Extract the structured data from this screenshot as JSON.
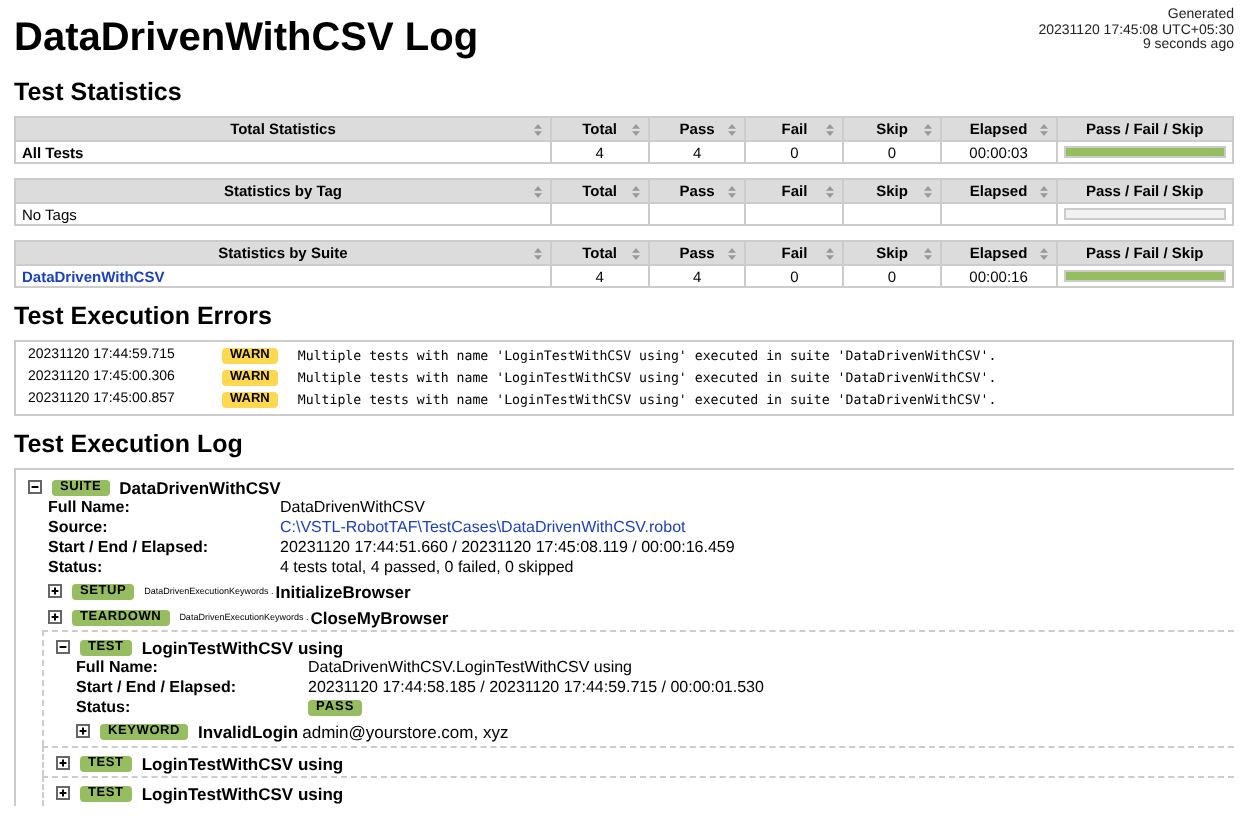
{
  "title": "DataDrivenWithCSV Log",
  "generated": {
    "label": "Generated",
    "timestamp": "20231120 17:45:08 UTC+05:30",
    "ago": "9 seconds ago"
  },
  "statistics": {
    "heading": "Test Statistics",
    "tables": [
      {
        "columns": [
          {
            "label": "Total Statistics",
            "sortable": true
          },
          {
            "label": "Total",
            "sortable": true
          },
          {
            "label": "Pass",
            "sortable": true
          },
          {
            "label": "Fail",
            "sortable": true
          },
          {
            "label": "Skip",
            "sortable": true
          },
          {
            "label": "Elapsed",
            "sortable": true
          },
          {
            "label": "Pass / Fail / Skip",
            "sortable": false
          }
        ],
        "rows": [
          {
            "label": "All Tests",
            "link": false,
            "bold": true,
            "total": "4",
            "pass": "4",
            "fail": "0",
            "skip": "0",
            "elapsed": "00:00:03",
            "level": 1
          }
        ]
      },
      {
        "columns": [
          {
            "label": "Statistics by Tag",
            "sortable": true
          },
          {
            "label": "Total",
            "sortable": true
          },
          {
            "label": "Pass",
            "sortable": true
          },
          {
            "label": "Fail",
            "sortable": true
          },
          {
            "label": "Skip",
            "sortable": true
          },
          {
            "label": "Elapsed",
            "sortable": true
          },
          {
            "label": "Pass / Fail / Skip",
            "sortable": false
          }
        ],
        "rows": [
          {
            "label": "No Tags",
            "link": false,
            "bold": false
          }
        ]
      },
      {
        "columns": [
          {
            "label": "Statistics by Suite",
            "sortable": true
          },
          {
            "label": "Total",
            "sortable": true
          },
          {
            "label": "Pass",
            "sortable": true
          },
          {
            "label": "Fail",
            "sortable": true
          },
          {
            "label": "Skip",
            "sortable": true
          },
          {
            "label": "Elapsed",
            "sortable": true
          },
          {
            "label": "Pass / Fail / Skip",
            "sortable": false
          }
        ],
        "rows": [
          {
            "label": "DataDrivenWithCSV",
            "link": true,
            "bold": true,
            "total": "4",
            "pass": "4",
            "fail": "0",
            "skip": "0",
            "elapsed": "00:00:16",
            "level": 1
          }
        ]
      }
    ]
  },
  "errors": {
    "heading": "Test Execution Errors",
    "items": [
      {
        "time": "20231120 17:44:59.715",
        "level": "WARN",
        "message": "Multiple tests with name 'LoginTestWithCSV using' executed in suite 'DataDrivenWithCSV'."
      },
      {
        "time": "20231120 17:45:00.306",
        "level": "WARN",
        "message": "Multiple tests with name 'LoginTestWithCSV using' executed in suite 'DataDrivenWithCSV'."
      },
      {
        "time": "20231120 17:45:00.857",
        "level": "WARN",
        "message": "Multiple tests with name 'LoginTestWithCSV using' executed in suite 'DataDrivenWithCSV'."
      }
    ]
  },
  "log": {
    "heading": "Test Execution Log",
    "suite": {
      "kind": "suite",
      "badge": "SUITE",
      "name": "DataDrivenWithCSV",
      "expanded": true,
      "meta": [
        {
          "label": "Full Name:",
          "value": "DataDrivenWithCSV",
          "kind": "text"
        },
        {
          "label": "Source:",
          "value": "C:\\VSTL-RobotTAF\\TestCases\\DataDrivenWithCSV.robot",
          "kind": "link"
        },
        {
          "label": "Start / End / Elapsed:",
          "value": "20231120 17:44:51.660 / 20231120 17:45:08.119 / 00:00:16.459",
          "kind": "text"
        },
        {
          "label": "Status:",
          "value": "4 tests total, 4 passed, 0 failed, 0 skipped",
          "kind": "text"
        }
      ],
      "children": [
        {
          "kind": "setup",
          "badge": "SETUP",
          "library": "DataDrivenExecutionKeywords .",
          "name": "InitializeBrowser",
          "expanded": false
        },
        {
          "kind": "teardown",
          "badge": "TEARDOWN",
          "library": "DataDrivenExecutionKeywords .",
          "name": "CloseMyBrowser",
          "expanded": false
        },
        {
          "kind": "test",
          "badge": "TEST",
          "name": "LoginTestWithCSV using",
          "expanded": true,
          "meta": [
            {
              "label": "Full Name:",
              "value": "DataDrivenWithCSV.LoginTestWithCSV using",
              "kind": "text"
            },
            {
              "label": "Start / End / Elapsed:",
              "value": "20231120 17:44:58.185 / 20231120 17:44:59.715 / 00:00:01.530",
              "kind": "text"
            },
            {
              "label": "Status:",
              "value": "PASS",
              "kind": "badge"
            }
          ],
          "children": [
            {
              "kind": "keyword",
              "badge": "KEYWORD",
              "name": "InvalidLogin",
              "args": "admin@yourstore.com, xyz",
              "expanded": false
            }
          ]
        },
        {
          "kind": "test",
          "badge": "TEST",
          "name": "LoginTestWithCSV using",
          "expanded": false
        },
        {
          "kind": "test",
          "badge": "TEST",
          "name": "LoginTestWithCSV using",
          "expanded": false
        }
      ]
    }
  }
}
